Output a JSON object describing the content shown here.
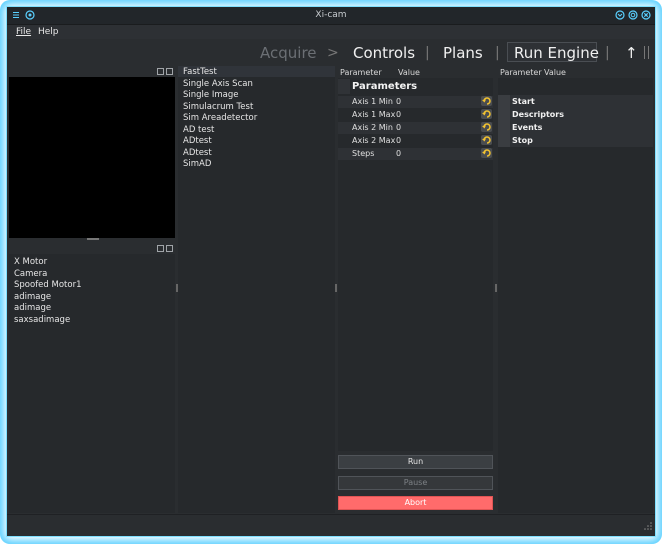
{
  "window": {
    "title": "Xi-cam"
  },
  "menubar": {
    "items": [
      {
        "label": "File"
      },
      {
        "label": "Help"
      }
    ]
  },
  "stages": [
    {
      "label": "Acquire",
      "active": false
    },
    {
      "label": "Controls",
      "active": true
    },
    {
      "label": "Plans",
      "active": true
    },
    {
      "label": "Run Engine",
      "active": true
    }
  ],
  "stage_separators": [
    ">",
    "|",
    "|",
    "|"
  ],
  "up_arrow": "↑",
  "devices": [
    "X Motor",
    "Camera",
    "Spoofed Motor1",
    "adimage",
    "adimage",
    "saxsadimage"
  ],
  "plans": [
    "FastTest",
    "Single Axis Scan",
    "Single Image",
    "Simulacrum Test",
    "Sim Areadetector",
    "AD test",
    "ADtest",
    "ADtest",
    "SimAD"
  ],
  "param_table": {
    "headers": [
      "Parameter",
      "Value"
    ],
    "group": "Parameters",
    "rows": [
      {
        "name": "Axis 1 Min",
        "value": "0",
        "resettable": true
      },
      {
        "name": "Axis 1 Max",
        "value": "0",
        "resettable": true
      },
      {
        "name": "Axis 2 Min",
        "value": "0",
        "resettable": true
      },
      {
        "name": "Axis 2 Max",
        "value": "0",
        "resettable": true
      },
      {
        "name": "Steps",
        "value": "0",
        "resettable": true
      }
    ]
  },
  "buttons": {
    "run": "Run",
    "pause": "Pause",
    "abort": "Abort"
  },
  "doc_table": {
    "headers": [
      "Parameter",
      "Value"
    ],
    "items": [
      "Start",
      "Descriptors",
      "Events",
      "Stop"
    ]
  },
  "colors": {
    "accent": "#5ad0ff",
    "abort": "#ff6b6b",
    "background": "#2a2d30"
  }
}
